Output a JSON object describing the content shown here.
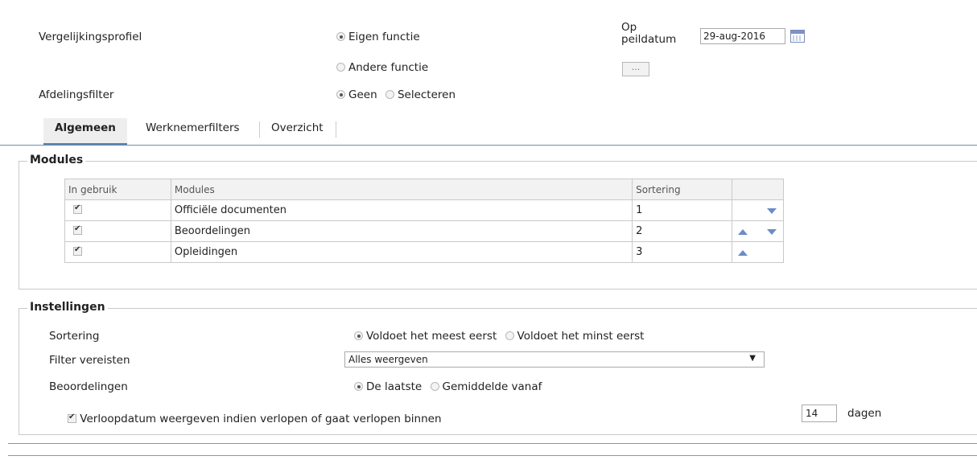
{
  "header": {
    "compare_profile_label": "Vergelijkingsprofiel",
    "own_function_label": "Eigen functie",
    "other_function_label": "Andere functie",
    "on_date_label_line1": "Op",
    "on_date_label_line2": "peildatum",
    "date_value": "29-aug-2016",
    "dots_button": "...",
    "department_filter_label": "Afdelingsfilter",
    "none_label": "Geen",
    "select_label": "Selecteren"
  },
  "tabs": [
    "Algemeen",
    "Werknemerfilters",
    "Overzicht"
  ],
  "modules_section": {
    "legend": "Modules",
    "columns": [
      "In gebruik",
      "Modules",
      "Sortering",
      ""
    ],
    "rows": [
      {
        "in_use": true,
        "module": "Officiële documenten",
        "sort": "1",
        "up": false,
        "down": true
      },
      {
        "in_use": true,
        "module": "Beoordelingen",
        "sort": "2",
        "up": true,
        "down": true
      },
      {
        "in_use": true,
        "module": "Opleidingen",
        "sort": "3",
        "up": true,
        "down": false
      }
    ]
  },
  "settings_section": {
    "legend": "Instellingen",
    "sorting_label": "Sortering",
    "sorting_opt1": "Voldoet het meest eerst",
    "sorting_opt2": "Voldoet het minst eerst",
    "filter_label": "Filter vereisten",
    "filter_value": "Alles weergeven",
    "reviews_label": "Beoordelingen",
    "reviews_opt1": "De laatste",
    "reviews_opt2": "Gemiddelde vanaf",
    "expiry_label": "Verloopdatum weergeven indien verlopen of gaat verlopen binnen",
    "days_value": "14",
    "days_unit": "dagen"
  }
}
